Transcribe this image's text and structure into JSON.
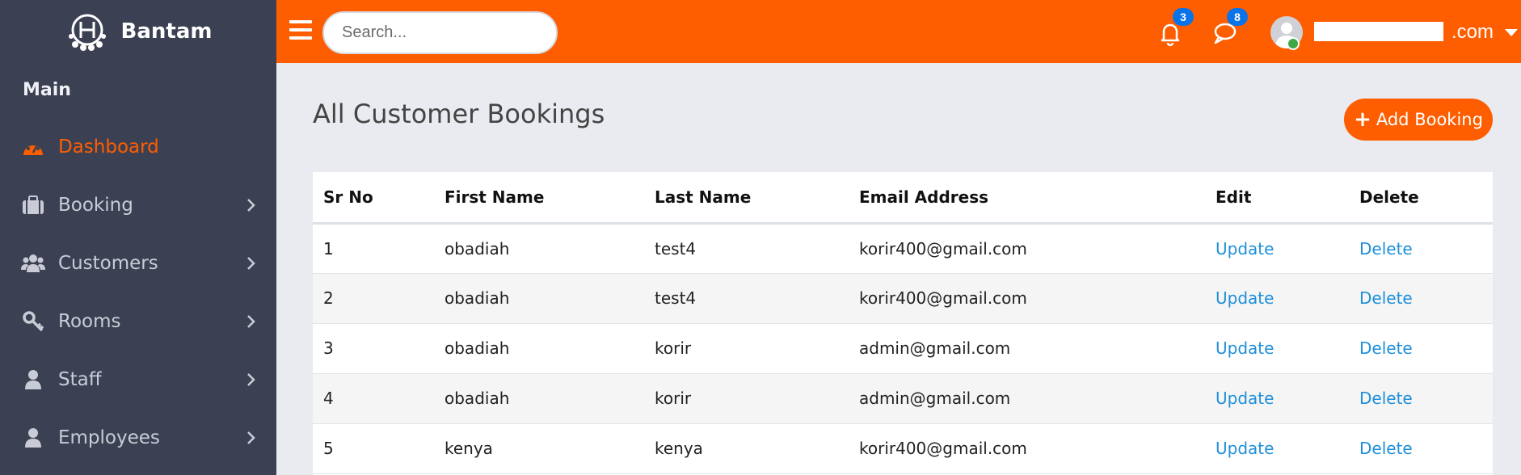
{
  "brand": {
    "name": "Bantam"
  },
  "sidebar": {
    "menu_title": "Main",
    "items": [
      {
        "label": "Dashboard",
        "icon": "dashboard-icon",
        "active": true,
        "has_submenu": false
      },
      {
        "label": "Booking",
        "icon": "briefcase-icon",
        "active": false,
        "has_submenu": true
      },
      {
        "label": "Customers",
        "icon": "users-icon",
        "active": false,
        "has_submenu": true
      },
      {
        "label": "Rooms",
        "icon": "key-icon",
        "active": false,
        "has_submenu": true
      },
      {
        "label": "Staff",
        "icon": "user-icon",
        "active": false,
        "has_submenu": true
      },
      {
        "label": "Employees",
        "icon": "user-icon",
        "active": false,
        "has_submenu": true
      }
    ]
  },
  "topbar": {
    "search_placeholder": "Search...",
    "notifications_count": "3",
    "messages_count": "8",
    "user_email_visible": ".com"
  },
  "main": {
    "title": "All Customer Bookings",
    "add_button_label": "Add Booking",
    "table": {
      "columns": [
        "Sr No",
        "First Name",
        "Last Name",
        "Email Address",
        "Edit",
        "Delete"
      ],
      "rows": [
        {
          "sr": "1",
          "first": "obadiah",
          "last": "test4",
          "email": "korir400@gmail.com",
          "edit": "Update",
          "delete": "Delete"
        },
        {
          "sr": "2",
          "first": "obadiah",
          "last": "test4",
          "email": "korir400@gmail.com",
          "edit": "Update",
          "delete": "Delete"
        },
        {
          "sr": "3",
          "first": "obadiah",
          "last": "korir",
          "email": "admin@gmail.com",
          "edit": "Update",
          "delete": "Delete"
        },
        {
          "sr": "4",
          "first": "obadiah",
          "last": "korir",
          "email": "admin@gmail.com",
          "edit": "Update",
          "delete": "Delete"
        },
        {
          "sr": "5",
          "first": "kenya",
          "last": "kenya",
          "email": "korir400@gmail.com",
          "edit": "Update",
          "delete": "Delete"
        }
      ]
    }
  },
  "colors": {
    "accent": "#fe5e00",
    "sidebar_bg": "#3c4053",
    "link": "#1e8fd9",
    "badge": "#0b73e8"
  }
}
